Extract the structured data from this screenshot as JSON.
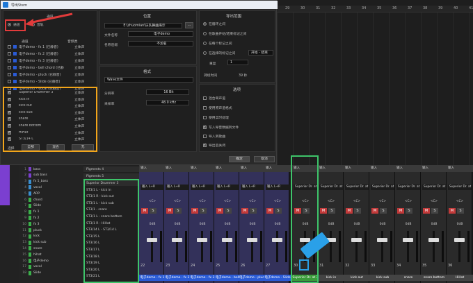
{
  "window": {
    "title": "导出Stem"
  },
  "tracks_section": {
    "tab_tracks": "通道",
    "tab_audio": "音轨",
    "col_channel": "通道",
    "col_type": "音频类",
    "rows": [
      {
        "name": "电子demo - fx 1 (已静音)",
        "type": "立体声",
        "checked": false,
        "kind": "bus"
      },
      {
        "name": "电子demo - fx 2 (已静音)",
        "type": "立体声",
        "checked": false,
        "kind": "bus"
      },
      {
        "name": "电子demo - fx 3 (已静音)",
        "type": "立体声",
        "checked": false,
        "kind": "bus"
      },
      {
        "name": "电子demo - bell chord (已静",
        "type": "立体声",
        "checked": false,
        "kind": "bus"
      },
      {
        "name": "电子demo - pluck (已静音)",
        "type": "立体声",
        "checked": false,
        "kind": "bus"
      },
      {
        "name": "电子demo - Slide (已静音)",
        "type": "立体声",
        "checked": false,
        "kind": "bus"
      },
      {
        "name": "电子demo - vocal (已静音)",
        "type": "立体声",
        "checked": false,
        "kind": "bus"
      },
      {
        "name": "Superior Drummer 3",
        "type": "立体声",
        "checked": true,
        "kind": "inst"
      },
      {
        "name": "kick in",
        "type": "立体声",
        "checked": true,
        "kind": "inst"
      },
      {
        "name": "kick out",
        "type": "立体声",
        "checked": true,
        "kind": "inst"
      },
      {
        "name": "kick sub",
        "type": "立体声",
        "checked": true,
        "kind": "inst"
      },
      {
        "name": "snare",
        "type": "立体声",
        "checked": true,
        "kind": "inst"
      },
      {
        "name": "snare bottom",
        "type": "立体声",
        "checked": true,
        "kind": "inst"
      },
      {
        "name": "HiHat",
        "type": "立体声",
        "checked": true,
        "kind": "inst"
      },
      {
        "name": "ST3/14 L",
        "type": "立体声",
        "checked": true,
        "kind": "inst"
      }
    ],
    "footer_label": "选择",
    "btn_all": "全部",
    "btn_mix": "混合",
    "btn_none": "无"
  },
  "location": {
    "title": "位置",
    "path": "E:\\zhuomian\\乐队舞曲海示",
    "browse": "...",
    "filename_label": "文件名称",
    "filename": "电子demo",
    "format_label": "名称后缀",
    "format_value": "不加名"
  },
  "format": {
    "title": "格式",
    "filetype": "Wave文件",
    "bitdepth_label": "分辨率",
    "bitdepth": "16 Bit",
    "samplerate_label": "采样率",
    "samplerate": "48.0 kHz"
  },
  "range": {
    "title": "导出范围",
    "opt1": "在循环之间",
    "opt2": "在歌曲开始/结束标记之间",
    "opt3": "在每个标记之间",
    "opt4": "在选择的标记之间",
    "opt4_sel": "开始 - 结束",
    "repeat_label": "重复",
    "repeat_val": "1",
    "duration_label": "持续时间",
    "duration_val": "39 秒"
  },
  "options": {
    "title": "选项",
    "o1": "混合单声道",
    "o2": "使用原声道格式",
    "o3": "使用实时处理",
    "o4": "写入导音数据到文件",
    "o5": "导入到歌曲",
    "o6": "导出后关闭"
  },
  "dialog_buttons": {
    "ok": "确定",
    "cancel": "取消"
  },
  "timeline": {
    "ticks": [
      "29",
      "30",
      "31",
      "32",
      "33",
      "34",
      "35",
      "36",
      "37",
      "38",
      "39",
      "40",
      "41"
    ]
  },
  "mixer": {
    "names": [
      {
        "n": "1",
        "t": "bass"
      },
      {
        "n": "2",
        "t": "sub bass"
      },
      {
        "n": "3",
        "t": "fx 1_bass"
      },
      {
        "n": "4",
        "t": "vocal"
      },
      {
        "n": "5",
        "t": "ARP"
      },
      {
        "n": "6",
        "t": "chord"
      },
      {
        "n": "7",
        "t": "Slide"
      },
      {
        "n": "8",
        "t": "fx 1"
      },
      {
        "n": "9",
        "t": "fx 2"
      },
      {
        "n": "10",
        "t": "fx 3"
      },
      {
        "n": "11",
        "t": "pluck"
      },
      {
        "n": "12",
        "t": "kick"
      },
      {
        "n": "13",
        "t": "kick sub"
      },
      {
        "n": "14",
        "t": "snare"
      },
      {
        "n": "15",
        "t": "hihat"
      },
      {
        "n": "16",
        "t": "电子demo"
      },
      {
        "n": "17",
        "t": "vocal"
      },
      {
        "n": "18",
        "t": "Slide"
      }
    ],
    "vlist_head1": "Pigments 4",
    "vlist_head2": "Pigments 5",
    "vlist_head3": "Superior Drummer 3",
    "vlist": [
      "ST3/1 L - kick in",
      "ST3/1 R - kick out",
      "ST3/1 L - kick sub",
      "ST3/1 - snare",
      "ST3/1 L - snare bottom",
      "ST3/1 R - HiHat",
      "ST3/14 L - ST3/14 L",
      "ST3/15 L",
      "ST3/16 L",
      "ST3/17 L",
      "ST3/18 L",
      "ST3/19 L",
      "ST3/20 L",
      "ST3/21 L"
    ],
    "strips": [
      {
        "hdr": "输入",
        "inst": "输入 L+R",
        "db": "0dB",
        "num": "22",
        "name": "电子demo - fx 1",
        "color": "#2a5bd6"
      },
      {
        "hdr": "输入",
        "inst": "输入 L+R",
        "db": "0dB",
        "num": "23",
        "name": "电子demo - fx 2",
        "color": "#2a5bd6"
      },
      {
        "hdr": "输入",
        "inst": "输入 L+R",
        "db": "0dB",
        "num": "24",
        "name": "电子demo - fx 3",
        "color": "#2a5bd6"
      },
      {
        "hdr": "输入",
        "inst": "输入 L+R",
        "db": "0dB",
        "num": "25",
        "name": "电子demo - bell",
        "color": "#2a5bd6"
      },
      {
        "hdr": "输入",
        "inst": "输入 L+R",
        "db": "0dB",
        "num": "26",
        "name": "电子demo - pluck",
        "color": "#2a5bd6"
      },
      {
        "hdr": "输入",
        "inst": "输入 L+R",
        "db": "0dB",
        "num": "27",
        "name": "电子demo - Slide",
        "color": "#2a5bd6"
      },
      {
        "hdr": "输入",
        "inst": "Superior Dr. at 3",
        "db": "0dB",
        "num": "30",
        "name": "Superior Dr. at 3",
        "color": "#3a9b3a"
      },
      {
        "hdr": "输入",
        "inst": "Superior Dr. at 3",
        "db": "0dB",
        "num": "31",
        "name": "kick in",
        "color": "#444"
      },
      {
        "hdr": "输入",
        "inst": "Superior Dr. at 3",
        "db": "0dB",
        "num": "32",
        "name": "kick out",
        "color": "#444"
      },
      {
        "hdr": "输入",
        "inst": "Superior Dr. at 3",
        "db": "0dB",
        "num": "33",
        "name": "kick sub",
        "color": "#444"
      },
      {
        "hdr": "输入",
        "inst": "Superior Dr. at 3",
        "db": "0dB",
        "num": "34",
        "name": "snare",
        "color": "#444"
      },
      {
        "hdr": "输入",
        "inst": "Superior Dr. at 3",
        "db": "0dB",
        "num": "35",
        "name": "snare bottom",
        "color": "#444"
      },
      {
        "hdr": "输入",
        "inst": "Superior Dr. at 3",
        "db": "0dB",
        "num": "36",
        "name": "HiHat",
        "color": "#444"
      }
    ],
    "pan_label": "<C>",
    "mute": "M",
    "solo": "S"
  },
  "colors": {
    "highlight_red": "#e23b3b",
    "highlight_orange": "#f2a51a",
    "highlight_green": "#3ec46a",
    "highlight_blue": "#2aa0e8"
  }
}
